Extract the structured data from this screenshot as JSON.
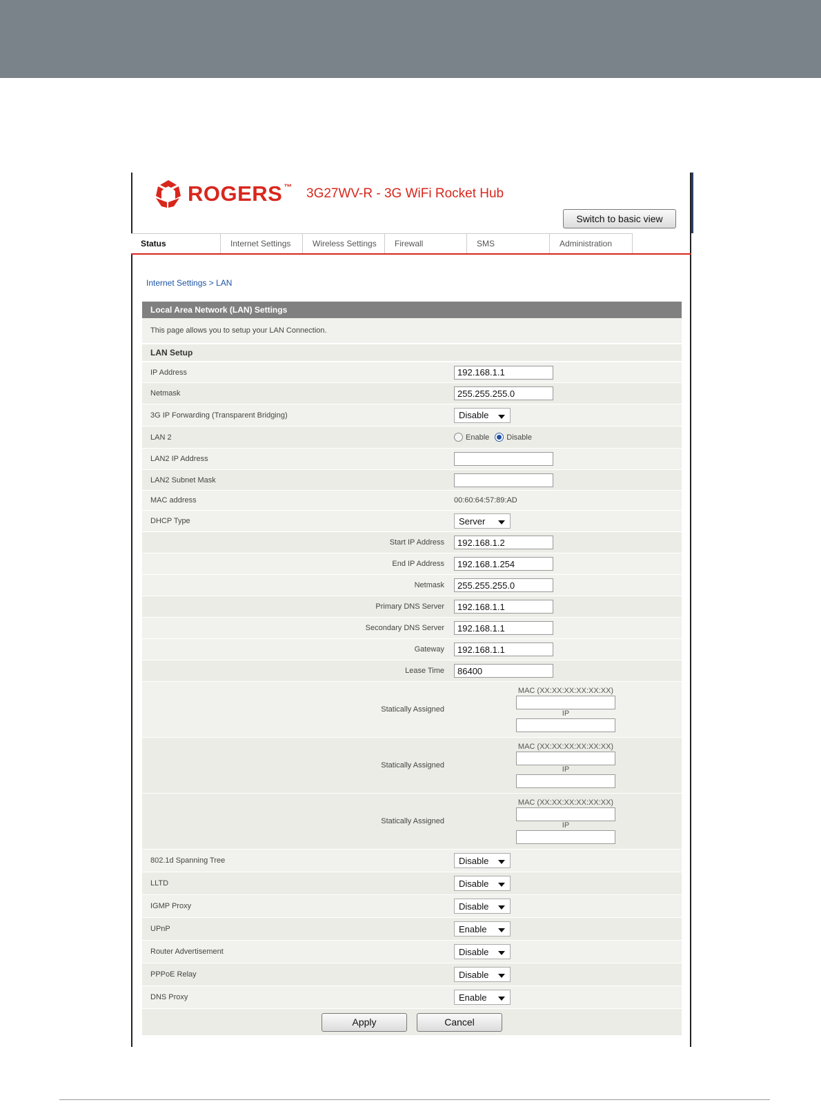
{
  "brand": {
    "logo_text": "ROGERS",
    "logo_tm": "™",
    "product": "3G27WV-R - 3G WiFi Rocket Hub",
    "color": "#d8271d"
  },
  "header": {
    "switch_view": "Switch to basic view"
  },
  "tabs": [
    {
      "label": "Status",
      "active": true
    },
    {
      "label": "Internet Settings"
    },
    {
      "label": "Wireless Settings"
    },
    {
      "label": "Firewall"
    },
    {
      "label": "SMS"
    },
    {
      "label": "Administration"
    }
  ],
  "breadcrumb": "Internet Settings > LAN",
  "section": {
    "title": "Local Area Network (LAN) Settings",
    "description": "This page allows you to setup your LAN Connection.",
    "subtitle": "LAN Setup"
  },
  "fields": {
    "ip_address": {
      "label": "IP Address",
      "value": "192.168.1.1"
    },
    "netmask": {
      "label": "Netmask",
      "value": "255.255.255.0"
    },
    "forwarding": {
      "label": "3G IP Forwarding (Transparent Bridging)",
      "value": "Disable"
    },
    "lan2": {
      "label": "LAN 2",
      "enable": "Enable",
      "disable": "Disable",
      "selected": "Disable"
    },
    "lan2_ip": {
      "label": "LAN2 IP Address",
      "value": ""
    },
    "lan2_mask": {
      "label": "LAN2 Subnet Mask",
      "value": ""
    },
    "mac": {
      "label": "MAC address",
      "value": "00:60:64:57:89:AD"
    },
    "dhcp_type": {
      "label": "DHCP Type",
      "value": "Server"
    },
    "start_ip": {
      "label": "Start IP Address",
      "value": "192.168.1.2"
    },
    "end_ip": {
      "label": "End IP Address",
      "value": "192.168.1.254"
    },
    "dhcp_netmask": {
      "label": "Netmask",
      "value": "255.255.255.0"
    },
    "primary_dns": {
      "label": "Primary DNS Server",
      "value": "192.168.1.1"
    },
    "secondary_dns": {
      "label": "Secondary DNS Server",
      "value": "192.168.1.1"
    },
    "gateway": {
      "label": "Gateway",
      "value": "192.168.1.1"
    },
    "lease_time": {
      "label": "Lease Time",
      "value": "86400"
    },
    "static": {
      "label": "Statically Assigned",
      "mac_caption": "MAC (XX:XX:XX:XX:XX:XX)",
      "ip_caption": "IP"
    },
    "spanning_tree": {
      "label": "802.1d Spanning Tree",
      "value": "Disable"
    },
    "lltd": {
      "label": "LLTD",
      "value": "Disable"
    },
    "igmp": {
      "label": "IGMP Proxy",
      "value": "Disable"
    },
    "upnp": {
      "label": "UPnP",
      "value": "Enable"
    },
    "router_adv": {
      "label": "Router Advertisement",
      "value": "Disable"
    },
    "pppoe": {
      "label": "PPPoE Relay",
      "value": "Disable"
    },
    "dns_proxy": {
      "label": "DNS Proxy",
      "value": "Enable"
    }
  },
  "actions": {
    "apply": "Apply",
    "cancel": "Cancel"
  }
}
